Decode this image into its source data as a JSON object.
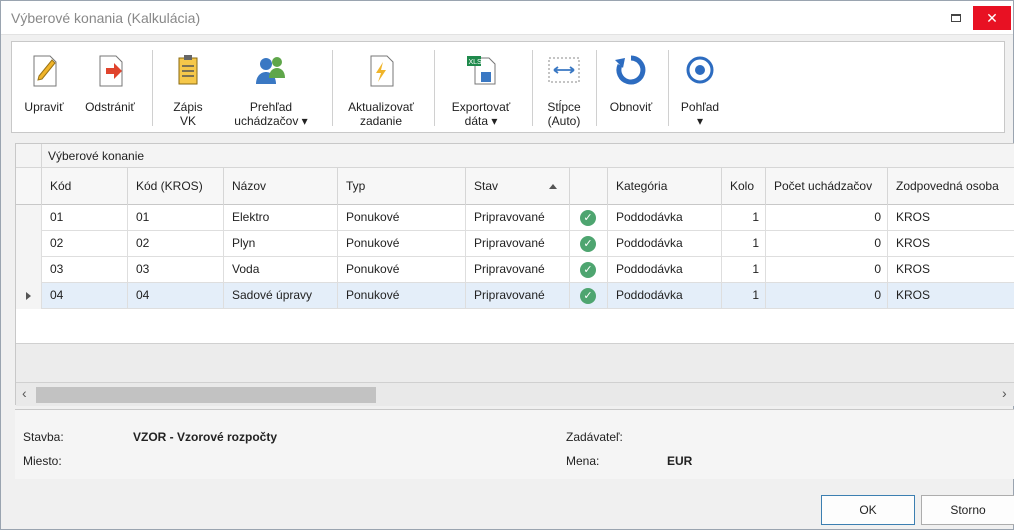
{
  "window": {
    "title": "Výberové konania (Kalkulácia)",
    "close": "✕"
  },
  "toolbar": {
    "edit": "Upraviť",
    "remove": "Odstrániť",
    "record_vk": "Zápis\nVK",
    "applicants": "Prehľad\nuchádzačov ▾",
    "update_order": "Aktualizovať\nzadanie",
    "export": "Exportovať\ndáta ▾",
    "columns": "Stĺpce\n(Auto)",
    "refresh": "Obnoviť",
    "view": "Pohľad\n▾"
  },
  "grid": {
    "group_label": "Výberové konanie",
    "columns": [
      "Kód",
      "Kód (KROS)",
      "Názov",
      "Typ",
      "Stav",
      "",
      "Kategória",
      "Kolo",
      "Počet uchádzačov",
      "Zodpovedná osoba"
    ],
    "rows": [
      {
        "kod": "01",
        "kros": "01",
        "nazov": "Elektro",
        "typ": "Ponukové",
        "stav": "Pripravované",
        "kategoria": "Poddodávka",
        "kolo": "1",
        "pocet": "0",
        "osoba": "KROS"
      },
      {
        "kod": "02",
        "kros": "02",
        "nazov": "Plyn",
        "typ": "Ponukové",
        "stav": "Pripravované",
        "kategoria": "Poddodávka",
        "kolo": "1",
        "pocet": "0",
        "osoba": "KROS"
      },
      {
        "kod": "03",
        "kros": "03",
        "nazov": "Voda",
        "typ": "Ponukové",
        "stav": "Pripravované",
        "kategoria": "Poddodávka",
        "kolo": "1",
        "pocet": "0",
        "osoba": "KROS"
      },
      {
        "kod": "04",
        "kros": "04",
        "nazov": "Sadové úpravy",
        "typ": "Ponukové",
        "stav": "Pripravované",
        "kategoria": "Poddodávka",
        "kolo": "1",
        "pocet": "0",
        "osoba": "KROS"
      }
    ]
  },
  "info": {
    "stavba_label": "Stavba:",
    "stavba_value": "VZOR - Vzorové rozpočty",
    "miesto_label": "Miesto:",
    "zadavatel_label": "Zadávateľ:",
    "mena_label": "Mena:",
    "mena_value": "EUR"
  },
  "buttons": {
    "ok": "OK",
    "cancel": "Storno"
  },
  "colors": {
    "accent": "#2d6cc0",
    "close": "#e81123",
    "status_ok": "#4ea570",
    "selected_row": "#e4eef9"
  }
}
